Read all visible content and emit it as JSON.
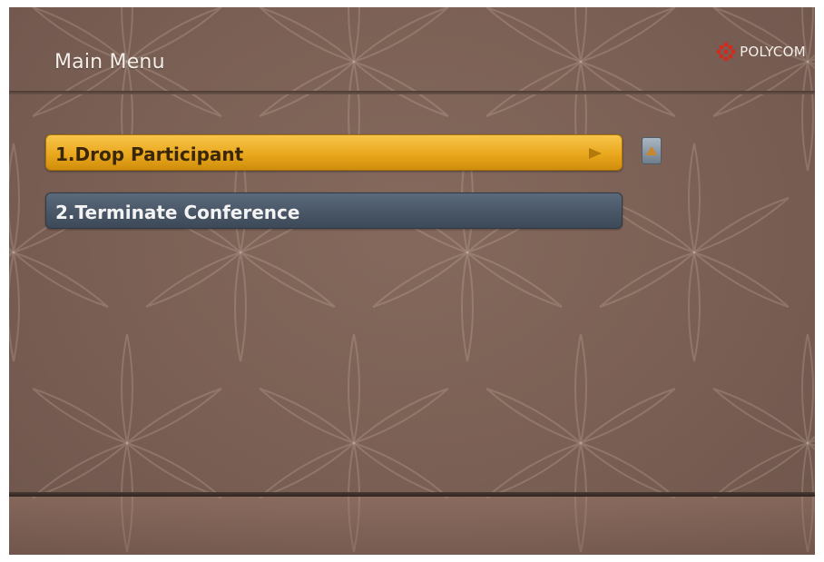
{
  "header": {
    "title": "Main Menu",
    "brand": "POLYCOM",
    "brand_icon": "polycom-logo-icon"
  },
  "menu": {
    "items": [
      {
        "label": "1.Drop Participant",
        "selected": true
      },
      {
        "label": "2.Terminate Conference",
        "selected": false
      }
    ],
    "scroll_icon": "scroll-up-icon"
  },
  "colors": {
    "background": "#7a5f54",
    "selected_item": "#eaa81e",
    "item": "#4a5868",
    "brand_red": "#d42a1e"
  }
}
